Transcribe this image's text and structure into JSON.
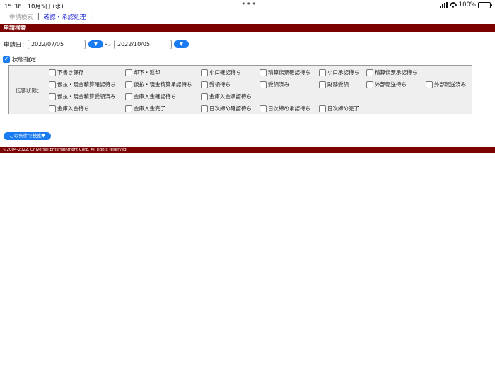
{
  "status_bar": {
    "time": "15:36",
    "date": "10月5日 (水)",
    "battery": "100%",
    "dots": "•••"
  },
  "tabs": {
    "sep": "|",
    "current": "申請検索",
    "link": "確認・承認処理"
  },
  "section_title": "申請検索",
  "date_filter": {
    "label": "申請日：",
    "from": "2022/07/05",
    "to": "2022/10/05",
    "tilde": "〜",
    "dropdown_glyph": "▼"
  },
  "status_filter": {
    "checkbox_glyph": "✓",
    "label": "状態指定",
    "checked": true
  },
  "panel": {
    "label": "伝票状態：",
    "rows": [
      [
        "下書き保存",
        "却下・返却",
        "小口確認待ち",
        "精算伝票確認待ち",
        "小口承認待ち",
        "精算伝票承認待ち",
        ""
      ],
      [
        "仮払・現金精算確認待ち",
        "仮払・現金精算承認待ち",
        "受領待ち",
        "受領済み",
        "財務受領",
        "外部転送待ち",
        "外部転送済み"
      ],
      [
        "仮払・現金精算受領済み",
        "金庫入金確認待ち",
        "金庫入金承認待ち",
        "",
        "",
        "",
        ""
      ],
      [
        "金庫入金待ち",
        "金庫入金完了",
        "日次締め確認待ち",
        "日次締め承認待ち",
        "日次締め完了",
        "",
        ""
      ]
    ]
  },
  "search_button": "この条件で検索▼",
  "footer": "©2004-2022, Universal Entertainment Corp.  All rights reserved."
}
